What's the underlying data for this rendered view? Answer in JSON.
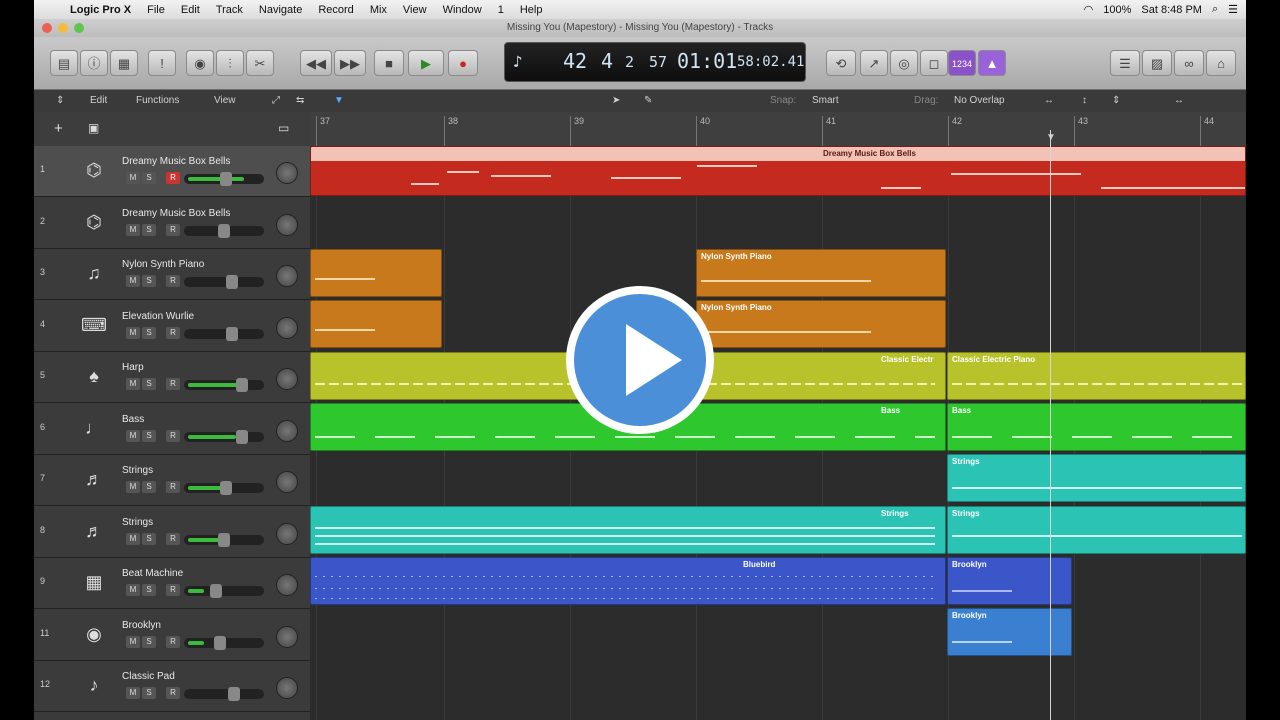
{
  "menubar": {
    "app": "Logic Pro X",
    "items": [
      "File",
      "Edit",
      "Track",
      "Navigate",
      "Record",
      "Mix",
      "View",
      "Window",
      "1",
      "Help"
    ],
    "battery": "100%",
    "clock": "Sat 8:48 PM"
  },
  "window": {
    "title": "Missing You (Mapestory) - Missing You (Mapestory) - Tracks"
  },
  "lcd": {
    "bar": "42",
    "beat": "4",
    "div": "2",
    "tick": "57",
    "time": "01:01",
    "frames": "58:02.41"
  },
  "editbar": {
    "edit": "Edit",
    "functions": "Functions",
    "view": "View",
    "snap_label": "Snap:",
    "snap_value": "Smart",
    "drag_label": "Drag:",
    "drag_value": "No Overlap"
  },
  "ruler": [
    "37",
    "38",
    "39",
    "40",
    "41",
    "42",
    "43",
    "44"
  ],
  "tracks": [
    {
      "num": "1",
      "name": "Dreamy Music Box Bells",
      "icon": "music-box-icon",
      "selected": true,
      "rec": true
    },
    {
      "num": "2",
      "name": "Dreamy Music Box Bells",
      "icon": "music-box-icon"
    },
    {
      "num": "3",
      "name": "Nylon Synth Piano",
      "icon": "piano-icon"
    },
    {
      "num": "4",
      "name": "Elevation Wurlie",
      "icon": "keyboard-icon"
    },
    {
      "num": "5",
      "name": "Harp",
      "icon": "harp-icon"
    },
    {
      "num": "6",
      "name": "Bass",
      "icon": "bass-guitar-icon"
    },
    {
      "num": "7",
      "name": "Strings",
      "icon": "strings-icon"
    },
    {
      "num": "8",
      "name": "Strings",
      "icon": "strings-icon"
    },
    {
      "num": "9",
      "name": "Beat Machine",
      "icon": "drum-machine-icon"
    },
    {
      "num": "11",
      "name": "Brooklyn",
      "icon": "drum-kit-icon"
    },
    {
      "num": "12",
      "name": "Classic Pad",
      "icon": "synth-icon"
    }
  ],
  "regions": {
    "dreamy": "Dreamy Music Box Bells",
    "nylon": "Nylon Synth Piano",
    "epiano": "Classic Electric Piano",
    "epiano_short": "Classic Electr",
    "bass": "Bass",
    "strings": "Strings",
    "bluebird": "Bluebird",
    "brooklyn": "Brooklyn"
  },
  "colors": {
    "red": "#c42a1e",
    "orange": "#c8791c",
    "yellow": "#b8c22a",
    "green": "#2ec82e",
    "teal": "#2bc4b4",
    "blue": "#3a56c8",
    "lightblue": "#3a7fd0",
    "play_overlay": "#4a8fd8"
  }
}
